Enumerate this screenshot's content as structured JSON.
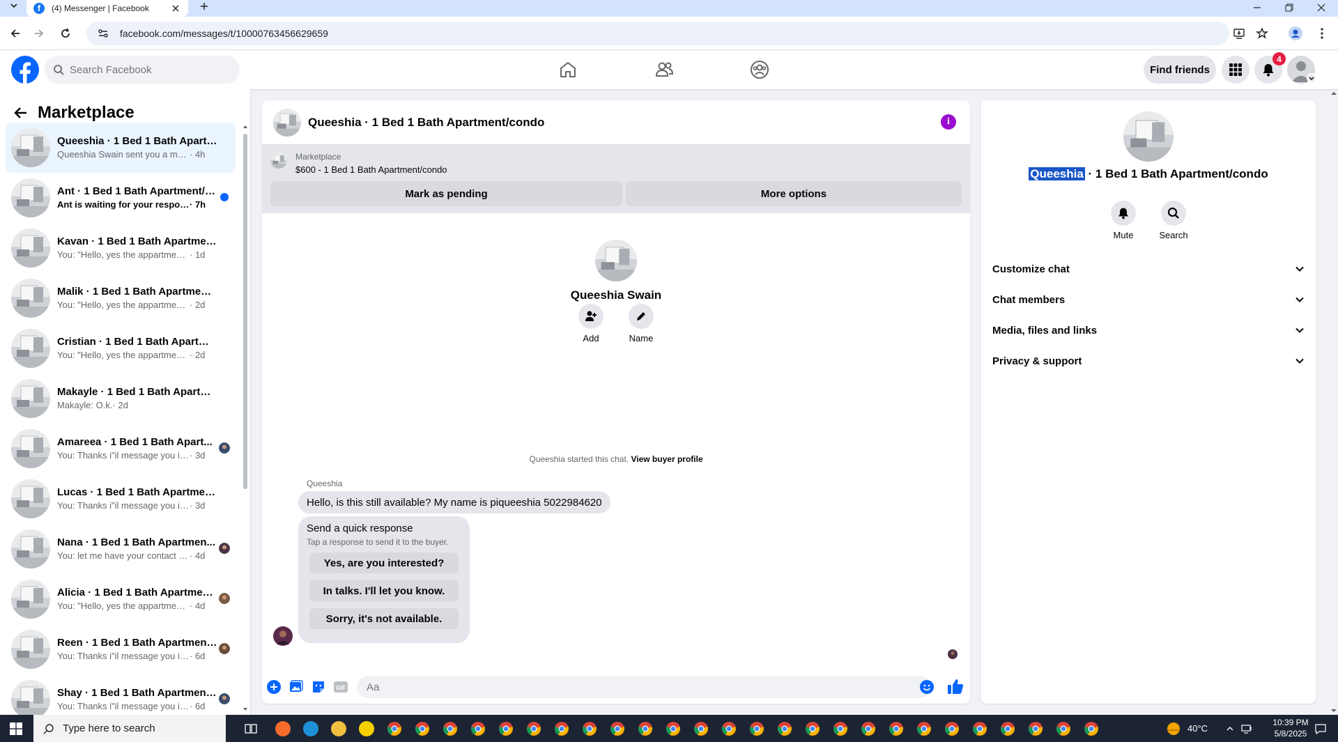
{
  "browser": {
    "tab_title": "(4) Messenger | Facebook",
    "url": "facebook.com/messages/t/10000763456629659"
  },
  "header": {
    "search_placeholder": "Search Facebook",
    "find_friends": "Find friends",
    "notification_count": "4"
  },
  "sidebar": {
    "title": "Marketplace",
    "conversations": [
      {
        "name": "Queeshia · 1 Bed 1 Bath Apartme...",
        "snippet": "Queeshia Swain sent you a messag...",
        "time": " · 4h",
        "status": "none",
        "active": true
      },
      {
        "name": "Ant · 1 Bed 1 Bath Apartment/c...",
        "snippet": "Ant is waiting for your response.",
        "time": " · 7h",
        "status": "unread"
      },
      {
        "name": "Kavan · 1 Bed 1 Bath Apartment/...",
        "snippet": "You: \"Hello, yes the appartmentis st...",
        "time": " · 1d",
        "status": "none"
      },
      {
        "name": "Malik · 1 Bed 1 Bath Apartment/...",
        "snippet": "You: \"Hello, yes the appartmentis st...",
        "time": " · 2d",
        "status": "none"
      },
      {
        "name": "Cristian · 1 Bed 1 Bath Apartmen...",
        "snippet": "You: \"Hello, yes the appartmentis st...",
        "time": " · 2d",
        "status": "none"
      },
      {
        "name": "Makayle · 1 Bed 1 Bath Apartme...",
        "snippet": "Makayle: O.k.",
        "time": " · 2d",
        "status": "none"
      },
      {
        "name": "Amareea · 1 Bed 1 Bath Apart...",
        "snippet": "You: Thanks i\"il message you in ...",
        "time": " · 3d",
        "status": "seen"
      },
      {
        "name": "Lucas · 1 Bed 1 Bath Apartment/...",
        "snippet": "You: Thanks i\"il message you in a ...",
        "time": " · 3d",
        "status": "none"
      },
      {
        "name": "Nana · 1 Bed 1 Bath Apartmen...",
        "snippet": "You: let me have your contact n...",
        "time": " · 4d",
        "status": "seen"
      },
      {
        "name": "Alicia · 1 Bed 1 Bath Apartmen...",
        "snippet": "You: \"Hello, yes the appartmenti...",
        "time": " · 4d",
        "status": "seen"
      },
      {
        "name": "Reen · 1 Bed 1 Bath Apartment...",
        "snippet": "You: Thanks i\"il message you in ...",
        "time": " · 6d",
        "status": "seen"
      },
      {
        "name": "Shay · 1 Bed 1 Bath Apartment...",
        "snippet": "You: Thanks i\"il message you in ...",
        "time": " · 6d",
        "status": "seen"
      }
    ]
  },
  "chat": {
    "title": "Queeshia · 1 Bed 1 Bath Apartment/condo",
    "marketplace_label": "Marketplace",
    "listing": "$600 - 1 Bed 1 Bath Apartment/condo",
    "mark_pending": "Mark as pending",
    "more_options": "More options",
    "contact_name": "Queeshia Swain",
    "add_label": "Add",
    "name_label": "Name",
    "started_text": "Queeshia started this chat.",
    "view_buyer": "View buyer profile",
    "sender": "Queeshia",
    "message": "Hello, is this still available? My name is piqueeshia 5022984620",
    "quick_title": "Send a quick response",
    "quick_subtitle": "Tap a response to send it to the buyer.",
    "quick_responses": [
      "Yes, are you interested?",
      "In talks. I'll let you know.",
      "Sorry, it's not available."
    ],
    "input_placeholder": "Aa"
  },
  "info_panel": {
    "name_highlight": "Queeshia",
    "name_rest": " · 1 Bed 1 Bath Apartment/condo",
    "mute": "Mute",
    "search": "Search",
    "sections": [
      "Customize chat",
      "Chat members",
      "Media, files and links",
      "Privacy & support"
    ]
  },
  "taskbar": {
    "search_placeholder": "Type here to search",
    "temperature": "40°C",
    "time": "10:39 PM",
    "date": "5/8/2025"
  },
  "colors": {
    "fb_blue": "#0866ff",
    "info_purple": "#9b0ecf",
    "notif_red": "#e41e3f",
    "active_row": "#ebf5ff"
  }
}
